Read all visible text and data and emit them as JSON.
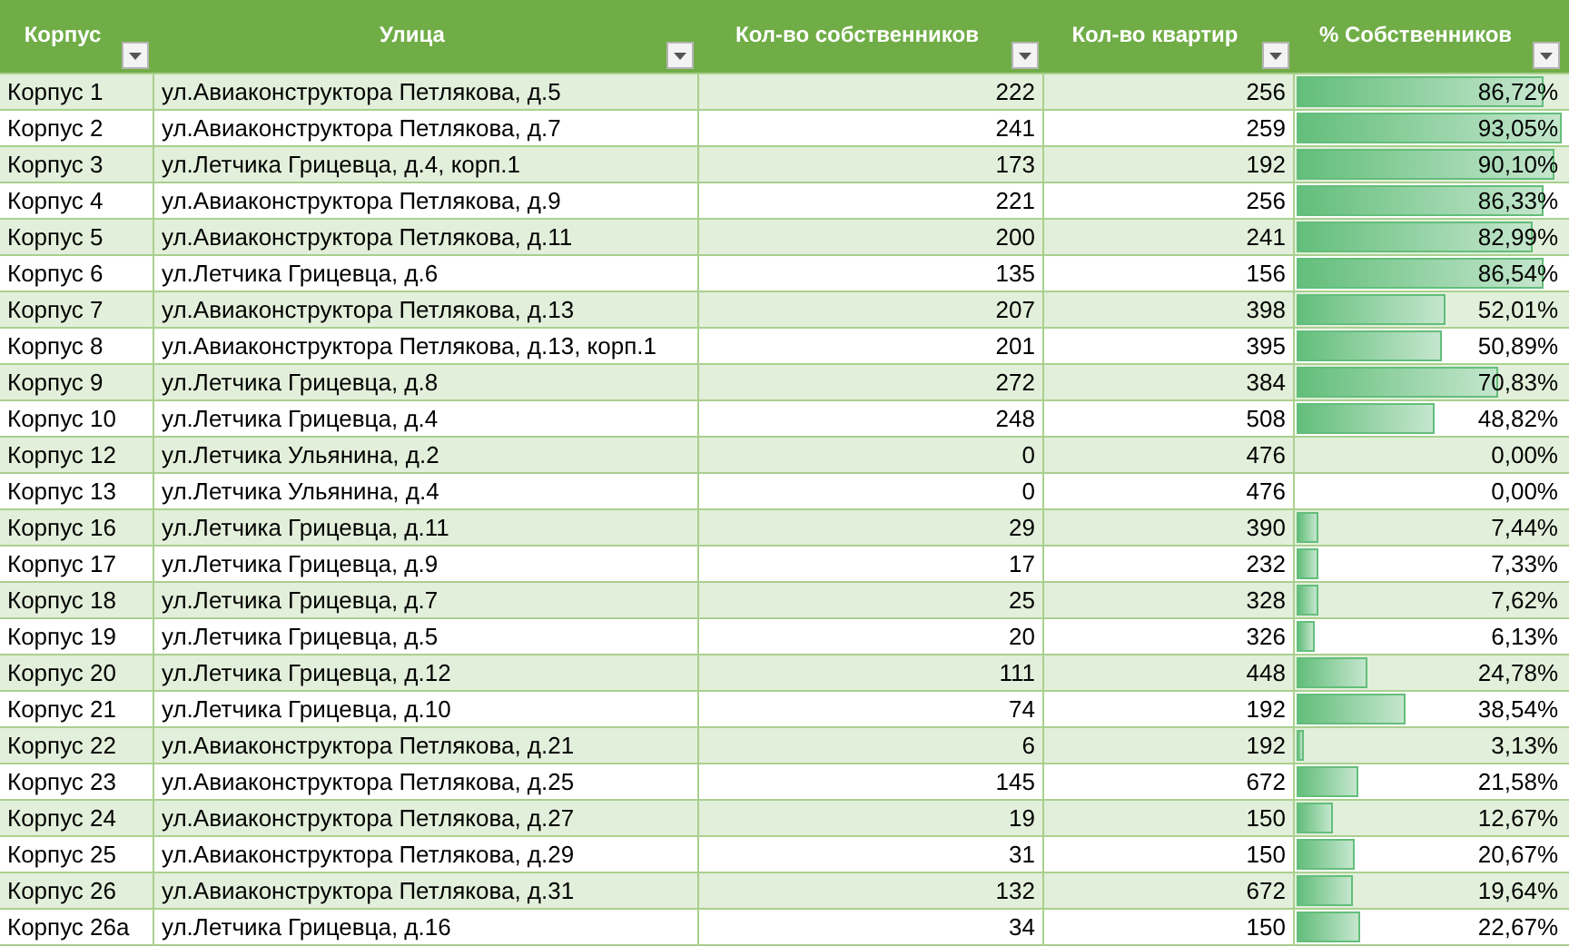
{
  "table": {
    "columns": [
      "Корпус",
      "Улица",
      "Кол-во собственников",
      "Кол-во квартир",
      "% Собственников"
    ],
    "rows": [
      {
        "building": "Корпус 1",
        "street": "ул.Авиаконструктора Петлякова, д.5",
        "owners": "222",
        "flats": "256",
        "percent": "86,72%",
        "level": 0.93
      },
      {
        "building": "Корпус 2",
        "street": "ул.Авиаконструктора Петлякова, д.7",
        "owners": "241",
        "flats": "259",
        "percent": "93,05%",
        "level": 1.0
      },
      {
        "building": "Корпус 3",
        "street": "ул.Летчика Грицевца, д.4, корп.1",
        "owners": "173",
        "flats": "192",
        "percent": "90,10%",
        "level": 0.97
      },
      {
        "building": "Корпус 4",
        "street": "ул.Авиаконструктора Петлякова, д.9",
        "owners": "221",
        "flats": "256",
        "percent": "86,33%",
        "level": 0.93
      },
      {
        "building": "Корпус 5",
        "street": "ул.Авиаконструктора Петлякова, д.11",
        "owners": "200",
        "flats": "241",
        "percent": "82,99%",
        "level": 0.89
      },
      {
        "building": "Корпус 6",
        "street": "ул.Летчика Грицевца, д.6",
        "owners": "135",
        "flats": "156",
        "percent": "86,54%",
        "level": 0.93
      },
      {
        "building": "Корпус 7",
        "street": "ул.Авиаконструктора Петлякова, д.13",
        "owners": "207",
        "flats": "398",
        "percent": "52,01%",
        "level": 0.56
      },
      {
        "building": "Корпус 8",
        "street": "ул.Авиаконструктора Петлякова, д.13, корп.1",
        "owners": "201",
        "flats": "395",
        "percent": "50,89%",
        "level": 0.55
      },
      {
        "building": "Корпус 9",
        "street": "ул.Летчика Грицевца, д.8",
        "owners": "272",
        "flats": "384",
        "percent": "70,83%",
        "level": 0.76
      },
      {
        "building": "Корпус 10",
        "street": "ул.Летчика Грицевца, д.4",
        "owners": "248",
        "flats": "508",
        "percent": "48,82%",
        "level": 0.52
      },
      {
        "building": "Корпус 12",
        "street": "ул.Летчика Ульянина, д.2",
        "owners": "0",
        "flats": "476",
        "percent": "0,00%"
      },
      {
        "building": "Корпус 13",
        "street": "ул.Летчика Ульянина, д.4",
        "owners": "0",
        "flats": "476",
        "percent": "0,00%"
      },
      {
        "building": "Корпус 16",
        "street": "ул.Летчика Грицевца, д.11",
        "owners": "29",
        "flats": "390",
        "percent": "7,44%",
        "level": 0.08
      },
      {
        "building": "Корпус 17",
        "street": "ул.Летчика Грицевца, д.9",
        "owners": "17",
        "flats": "232",
        "percent": "7,33%",
        "level": 0.08
      },
      {
        "building": "Корпус 18",
        "street": "ул.Летчика Грицевца, д.7",
        "owners": "25",
        "flats": "328",
        "percent": "7,62%",
        "level": 0.08
      },
      {
        "building": "Корпус 19",
        "street": "ул.Летчика Грицевца, д.5",
        "owners": "20",
        "flats": "326",
        "percent": "6,13%",
        "level": 0.07
      },
      {
        "building": "Корпус 20",
        "street": "ул.Летчика Грицевца, д.12",
        "owners": "111",
        "flats": "448",
        "percent": "24,78%",
        "level": 0.27
      },
      {
        "building": "Корпус 21",
        "street": "ул.Летчика Грицевца, д.10",
        "owners": "74",
        "flats": "192",
        "percent": "38,54%",
        "level": 0.41
      },
      {
        "building": "Корпус 22",
        "street": "ул.Авиаконструктора Петлякова, д.21",
        "owners": "6",
        "flats": "192",
        "percent": "3,13%",
        "level": 0.03
      },
      {
        "building": "Корпус 23",
        "street": "ул.Авиаконструктора Петлякова, д.25",
        "owners": "145",
        "flats": "672",
        "percent": "21,58%",
        "level": 0.23
      },
      {
        "building": "Корпус 24",
        "street": "ул.Авиаконструктора Петлякова, д.27",
        "owners": "19",
        "flats": "150",
        "percent": "12,67%",
        "level": 0.14
      },
      {
        "building": "Корпус 25",
        "street": "ул.Авиаконструктора Петлякова, д.29",
        "owners": "31",
        "flats": "150",
        "percent": "20,67%",
        "level": 0.22
      },
      {
        "building": "Корпус 26",
        "street": "ул.Авиаконструктора Петлякова, д.31",
        "owners": "132",
        "flats": "672",
        "percent": "19,64%",
        "level": 0.21
      },
      {
        "building": "Корпус 26а",
        "street": "ул.Летчика Грицевца, д.16",
        "owners": "34",
        "flats": "150",
        "percent": "22,67%",
        "level": 0.24
      }
    ]
  }
}
